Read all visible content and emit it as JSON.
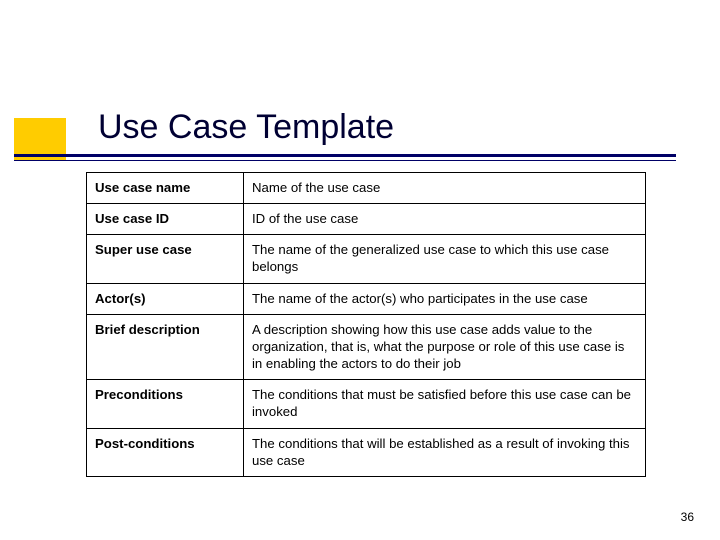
{
  "title": "Use Case Template",
  "rows": [
    {
      "label": "Use case name",
      "desc": "Name of the use case"
    },
    {
      "label": "Use case ID",
      "desc": "ID of the use case"
    },
    {
      "label": "Super use case",
      "desc": "The name of the generalized use case to which this use case belongs"
    },
    {
      "label": "Actor(s)",
      "desc": "The name of the actor(s) who participates in the use case"
    },
    {
      "label": "Brief description",
      "desc": "A description showing how this use case adds value to the organization, that is, what the purpose or role of this use case is in enabling the actors to do their job"
    },
    {
      "label": "Preconditions",
      "desc": "The conditions that must be satisfied before this use case can be invoked"
    },
    {
      "label": "Post-conditions",
      "desc": "The conditions that will be established as a result of invoking this use case"
    }
  ],
  "pageNumber": "36"
}
